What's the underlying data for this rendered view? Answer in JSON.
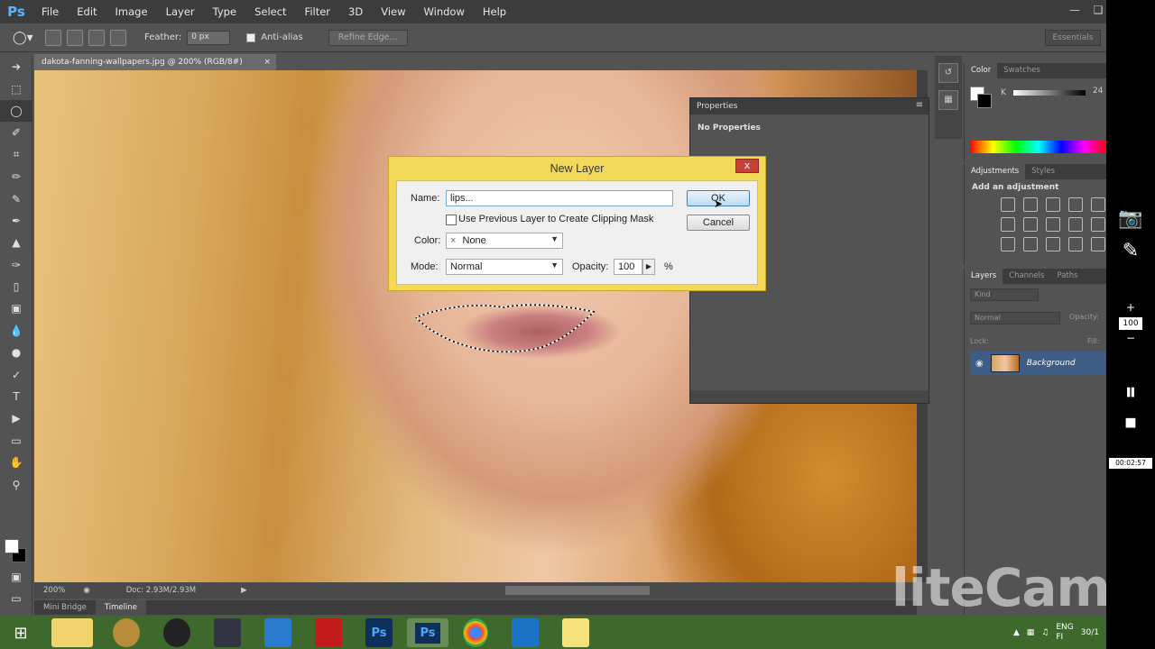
{
  "app": {
    "logo": "Ps",
    "menu": [
      "File",
      "Edit",
      "Image",
      "Layer",
      "Type",
      "Select",
      "Filter",
      "3D",
      "View",
      "Window",
      "Help"
    ]
  },
  "options": {
    "feather_label": "Feather:",
    "feather_value": "0 px",
    "antialias_label": "Anti-alias",
    "refine_edge": "Refine Edge...",
    "workspace": "Essentials"
  },
  "document": {
    "tab": "dakota-fanning-wallpapers.jpg @ 200% (RGB/8#)",
    "zoom": "200%",
    "doc_size": "Doc: 2.93M/2.93M",
    "bottom_tabs": [
      "Mini Bridge",
      "Timeline"
    ]
  },
  "properties": {
    "title": "Properties",
    "body": "No Properties"
  },
  "color_panel": {
    "tabs": [
      "Color",
      "Swatches"
    ],
    "k_label": "K",
    "k_value": "24"
  },
  "adjustments": {
    "tabs": [
      "Adjustments",
      "Styles"
    ],
    "title": "Add an adjustment"
  },
  "layers": {
    "tabs": [
      "Layers",
      "Channels",
      "Paths"
    ],
    "kind": "Kind",
    "blend": "Normal",
    "opacity_label": "Opacity:",
    "lock_label": "Lock:",
    "fill_label": "Fill:",
    "layer_name": "Background"
  },
  "dialog": {
    "title": "New Layer",
    "close": "x",
    "name_label": "Name:",
    "name_value": "lips...",
    "clip_label": "Use Previous Layer to Create Clipping Mask",
    "color_label": "Color:",
    "color_value": "None",
    "color_x": "×",
    "mode_label": "Mode:",
    "mode_value": "Normal",
    "opacity_label": "Opacity:",
    "opacity_value": "100",
    "opacity_unit": "%",
    "ok": "OK",
    "cancel": "Cancel"
  },
  "taskbar": {
    "apps": [
      "folder",
      "media",
      "camera",
      "video",
      "store",
      "power",
      "ps1",
      "ps2",
      "chrome",
      "remote",
      "notes"
    ],
    "ps_label": "Ps",
    "lang": "ENG",
    "lang2": "FI",
    "date": "30/1"
  },
  "recorder": {
    "level": "100",
    "time": "00:02:57",
    "watermark": "liteCam"
  },
  "colors": {
    "dialog_frame": "#f3d95a",
    "selected_layer": "#3d5c86",
    "taskbar": "#3d6a2c"
  }
}
